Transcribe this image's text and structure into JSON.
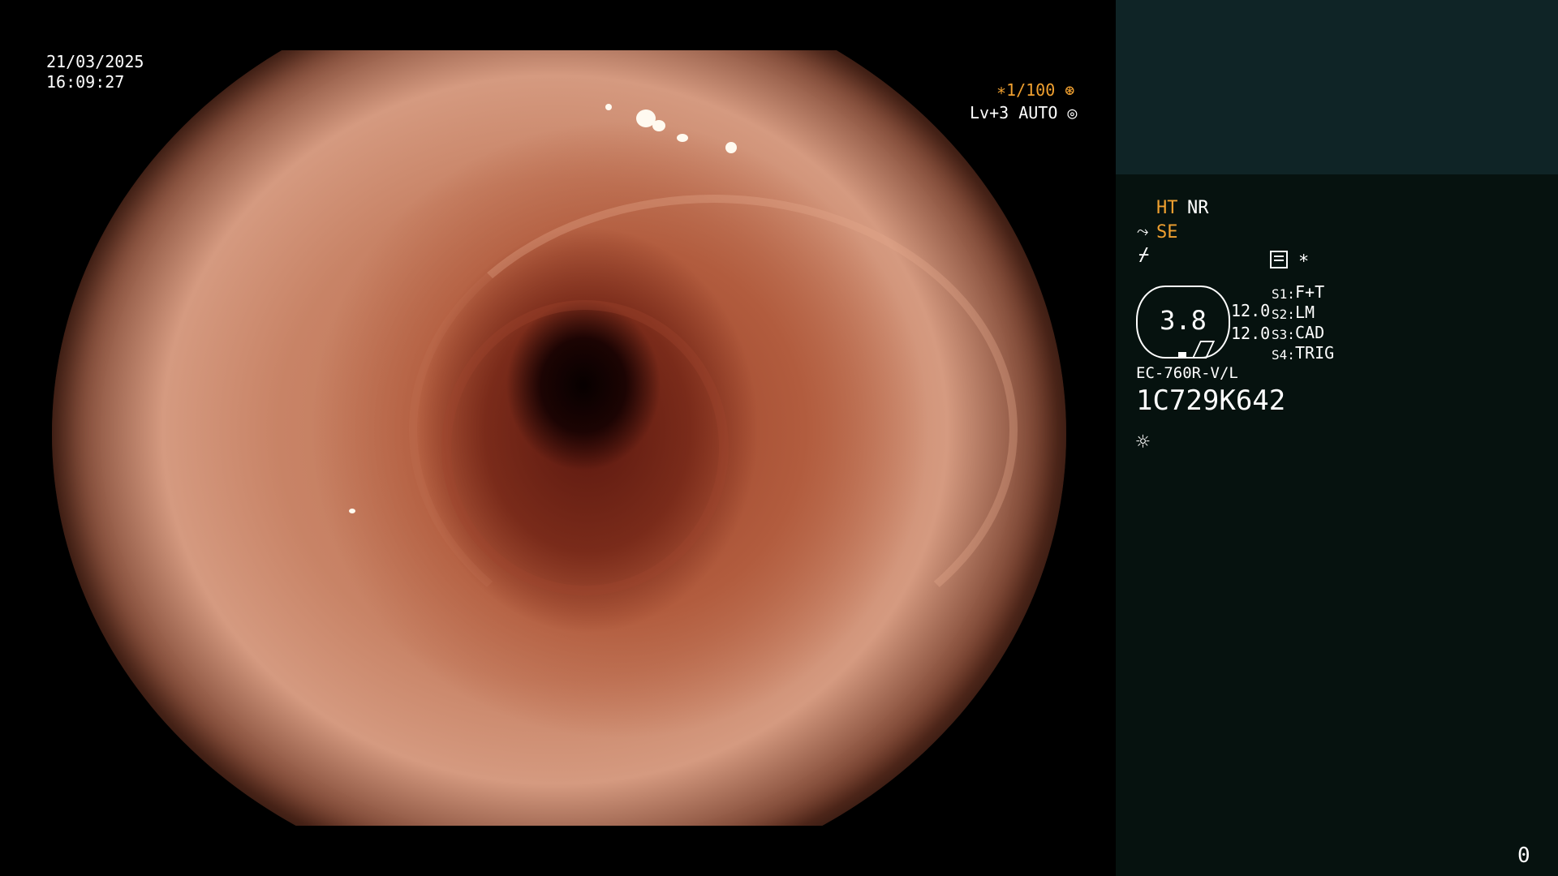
{
  "datetime": {
    "date": "21/03/2025",
    "time": "16:09:27"
  },
  "shutter": {
    "value": "∗1/100",
    "icon": "shutter-icon"
  },
  "iris": {
    "value": "Lv+3 AUTO",
    "icon": "iris-icon"
  },
  "panel": {
    "ht": "HT",
    "nr": "NR",
    "se": "SE",
    "se_icon": "scope-icon",
    "mode_glyph": "⌿",
    "menu_icon": "menu-icon",
    "asterisk": "∗",
    "gauge_value": "3.8",
    "gauge_left_top": "12.0",
    "gauge_left_bottom": "12.0",
    "switches": [
      {
        "key": "S1:",
        "value": "F+T"
      },
      {
        "key": "S2:",
        "value": "LM"
      },
      {
        "key": "S3:",
        "value": "CAD"
      },
      {
        "key": "S4:",
        "value": "TRIG"
      }
    ],
    "model": "EC-760R-V/L",
    "serial": "1C729K642",
    "light_icon": "sun-icon",
    "counter": "0"
  },
  "colors": {
    "orange_accent": "#f0a030",
    "panel_dark": "#06120f",
    "panel_top": "#0f2426"
  }
}
